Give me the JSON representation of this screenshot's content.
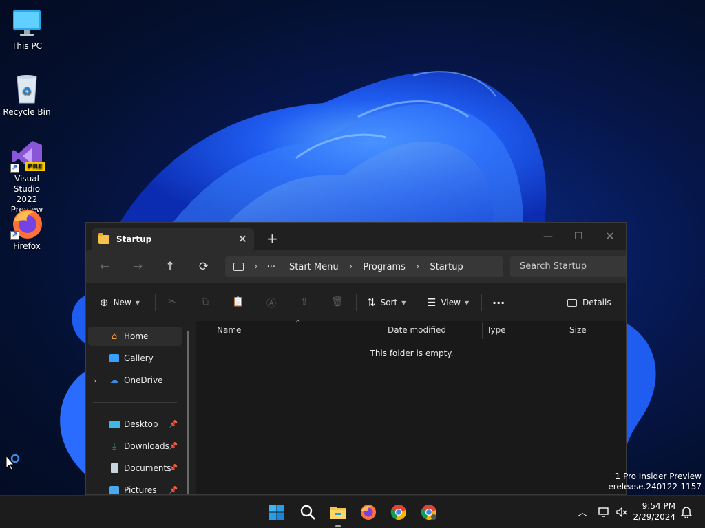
{
  "desktop": {
    "icons": [
      {
        "label_l1": "This PC",
        "label_l2": "",
        "icon": "monitor-icon"
      },
      {
        "label_l1": "Recycle Bin",
        "label_l2": "",
        "icon": "recycle-bin-icon"
      },
      {
        "label_l1": "Visual Studio",
        "label_l2": "2022 Preview",
        "icon": "visual-studio-icon",
        "badge": "PRE"
      },
      {
        "label_l1": "Firefox",
        "label_l2": "",
        "icon": "firefox-icon"
      }
    ],
    "watermark": {
      "line1": "1 Pro Insider Preview",
      "line2": "erelease.240122-1157"
    }
  },
  "explorer": {
    "tab": {
      "title": "Startup",
      "close": "✕"
    },
    "new_tab": "+",
    "window_controls": {
      "minimize": "—",
      "maximize": "☐",
      "close": "✕"
    },
    "breadcrumb": {
      "overflow": "···",
      "items": [
        "Start Menu",
        "Programs",
        "Startup"
      ]
    },
    "search": {
      "placeholder": "Search Startup"
    },
    "toolbar": {
      "new_label": "New",
      "sort_label": "Sort",
      "view_label": "View",
      "more_label": "···",
      "details_label": "Details"
    },
    "nav": {
      "items": [
        {
          "label": "Home",
          "icon": "home-icon"
        },
        {
          "label": "Gallery",
          "icon": "gallery-icon"
        },
        {
          "label": "OneDrive",
          "icon": "onedrive-icon"
        },
        {
          "label": "Desktop",
          "icon": "desktop-folder-icon"
        },
        {
          "label": "Downloads",
          "icon": "downloads-icon"
        },
        {
          "label": "Documents",
          "icon": "documents-icon"
        },
        {
          "label": "Pictures",
          "icon": "pictures-icon"
        }
      ]
    },
    "columns": [
      "Name",
      "Date modified",
      "Type",
      "Size"
    ],
    "empty_message": "This folder is empty."
  },
  "taskbar": {
    "apps": [
      "start-icon",
      "search-icon",
      "file-explorer-icon",
      "firefox-icon",
      "chrome-icon",
      "chrome-canary-icon"
    ],
    "time": "9:54 PM",
    "date": "2/29/2024"
  },
  "colors": {
    "accent": "#0078d4",
    "window_bg": "#202020",
    "folder": "#f5c24b"
  }
}
